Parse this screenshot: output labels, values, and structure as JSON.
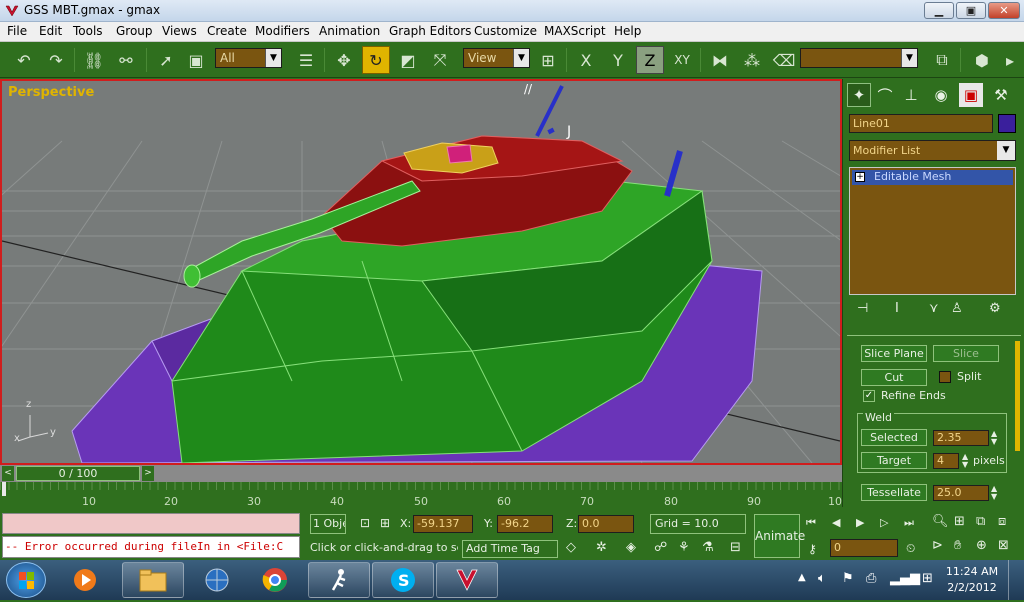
{
  "window": {
    "title": "GSS MBT.gmax - gmax",
    "controls": {
      "minimize": "▁",
      "maximize": "▣",
      "close": "✕"
    }
  },
  "menu": [
    "File",
    "Edit",
    "Tools",
    "Group",
    "Views",
    "Create",
    "Modifiers",
    "Animation",
    "Graph Editors",
    "Customize",
    "MAXScript",
    "Help"
  ],
  "toolbar": {
    "selection_filter": "All",
    "reference_coord": "View",
    "axis_x": "X",
    "axis_y": "Y",
    "axis_z": "Z",
    "axis_xy": "XY",
    "named_selection": ""
  },
  "viewport": {
    "label": "Perspective",
    "axis_labels": {
      "x": "x",
      "y": "y",
      "z": "z"
    }
  },
  "command_panel": {
    "object_name": "Line01",
    "object_color": "#3a1f9c",
    "modifier_list": "Modifier List",
    "stack_item": "Editable Mesh",
    "slice_plane": "Slice Plane",
    "slice": "Slice",
    "cut": "Cut",
    "split": "Split",
    "refine_ends": "Refine Ends",
    "weld_group": "Weld",
    "weld_selected": "Selected",
    "weld_selected_value": "2.35",
    "weld_target": "Target",
    "weld_target_value": "4",
    "weld_target_unit": "pixels",
    "tessellate": "Tessellate",
    "tessellate_value": "25.0"
  },
  "timeline": {
    "frame_display": "0 / 100",
    "ticks": [
      "10",
      "20",
      "30",
      "40",
      "50",
      "60",
      "70",
      "80",
      "90",
      "10"
    ]
  },
  "status": {
    "maxscript_listener": "",
    "error_text": "-- Error occurred during fileIn in <File:C",
    "selection_count": "1 Obje",
    "x_label": "X:",
    "x_value": "-59.137",
    "y_label": "Y:",
    "y_value": "-96.2",
    "z_label": "Z:",
    "z_value": "0.0",
    "grid": "Grid = 10.0",
    "prompt": "Click or click-and-drag to selec",
    "add_time_tag": "Add Time Tag",
    "animate": "Animate",
    "current_frame": "0"
  },
  "taskbar": {
    "time": "11:24 AM",
    "date": "2/2/2012"
  },
  "colors": {
    "ui_green": "#2f6f1e",
    "field_brown": "#7a5510",
    "active_yellow": "#e0b400",
    "viewport_border": "#d01d1d",
    "tank_hull": "#1f8a1a",
    "tank_turret": "#8b1010",
    "tank_tracks": "#6a34b8"
  }
}
